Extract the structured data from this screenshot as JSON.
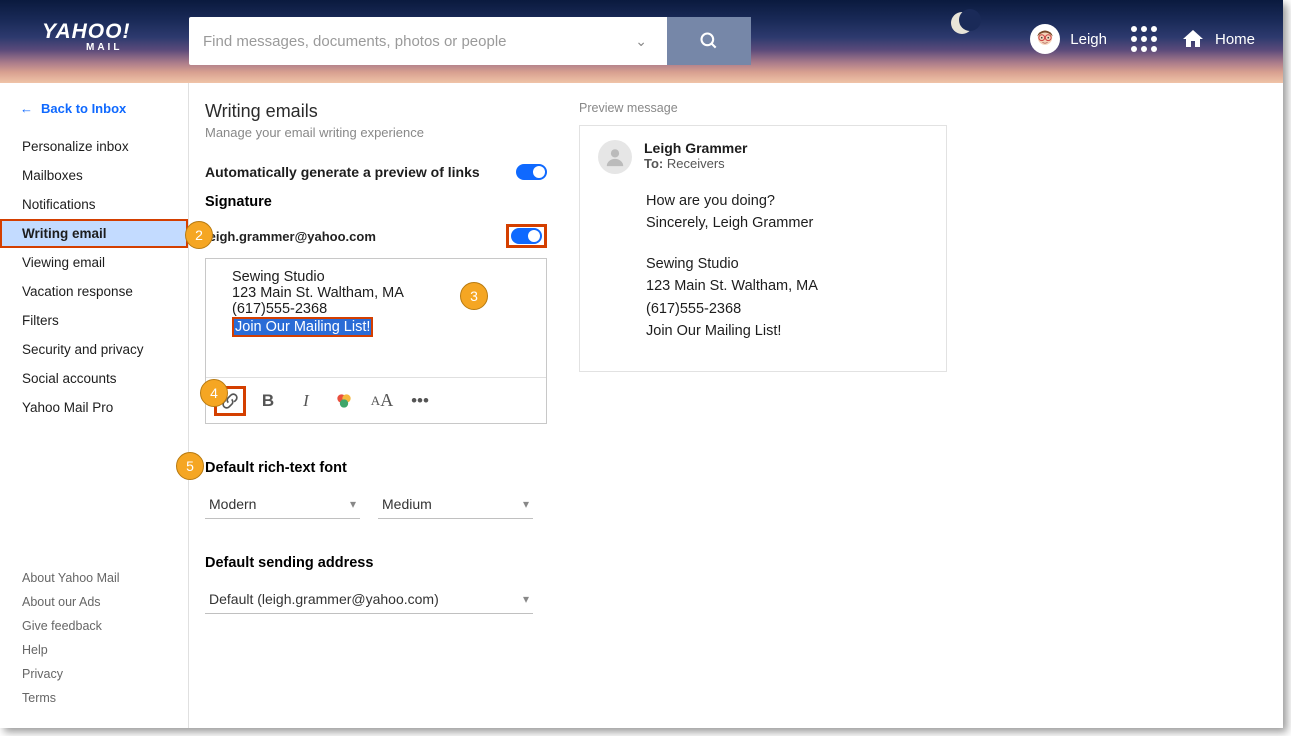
{
  "logo": {
    "main": "YAHOO!",
    "sub": "MAIL"
  },
  "search": {
    "placeholder": "Find messages, documents, photos or people"
  },
  "user": {
    "name": "Leigh"
  },
  "home_label": "Home",
  "back_label": "Back to Inbox",
  "nav": {
    "items": [
      {
        "label": "Personalize inbox"
      },
      {
        "label": "Mailboxes"
      },
      {
        "label": "Notifications"
      },
      {
        "label": "Writing email",
        "active": true
      },
      {
        "label": "Viewing email"
      },
      {
        "label": "Vacation response"
      },
      {
        "label": "Filters"
      },
      {
        "label": "Security and privacy"
      },
      {
        "label": "Social accounts"
      },
      {
        "label": "Yahoo Mail Pro"
      }
    ]
  },
  "footer": [
    "About Yahoo Mail",
    "About our Ads",
    "Give feedback",
    "Help",
    "Privacy",
    "Terms"
  ],
  "settings": {
    "title": "Writing emails",
    "subtitle": "Manage your email writing experience",
    "auto_preview": "Automatically generate a preview of links",
    "signature_label": "Signature",
    "email": "leigh.grammer@yahoo.com",
    "sig": {
      "line1": "Sewing Studio",
      "line2": "123 Main St. Waltham, MA",
      "line3": "(617)555-2368",
      "line4": "Join Our Mailing List!"
    },
    "font_section": "Default rich-text font",
    "font_family": "Modern",
    "font_size": "Medium",
    "address_section": "Default sending address",
    "address_value": "Default (leigh.grammer@yahoo.com)"
  },
  "preview": {
    "title": "Preview message",
    "from": "Leigh Grammer",
    "to_label": "To:",
    "to_value": "Receivers",
    "line1": "How are you doing?",
    "line2": "Sincerely,  Leigh Grammer",
    "sig1": "Sewing Studio",
    "sig2": "123 Main St. Waltham, MA",
    "sig3": "(617)555-2368",
    "sig4": "Join Our Mailing List!"
  },
  "callouts": {
    "c2": "2",
    "c3": "3",
    "c4": "4",
    "c5": "5"
  }
}
